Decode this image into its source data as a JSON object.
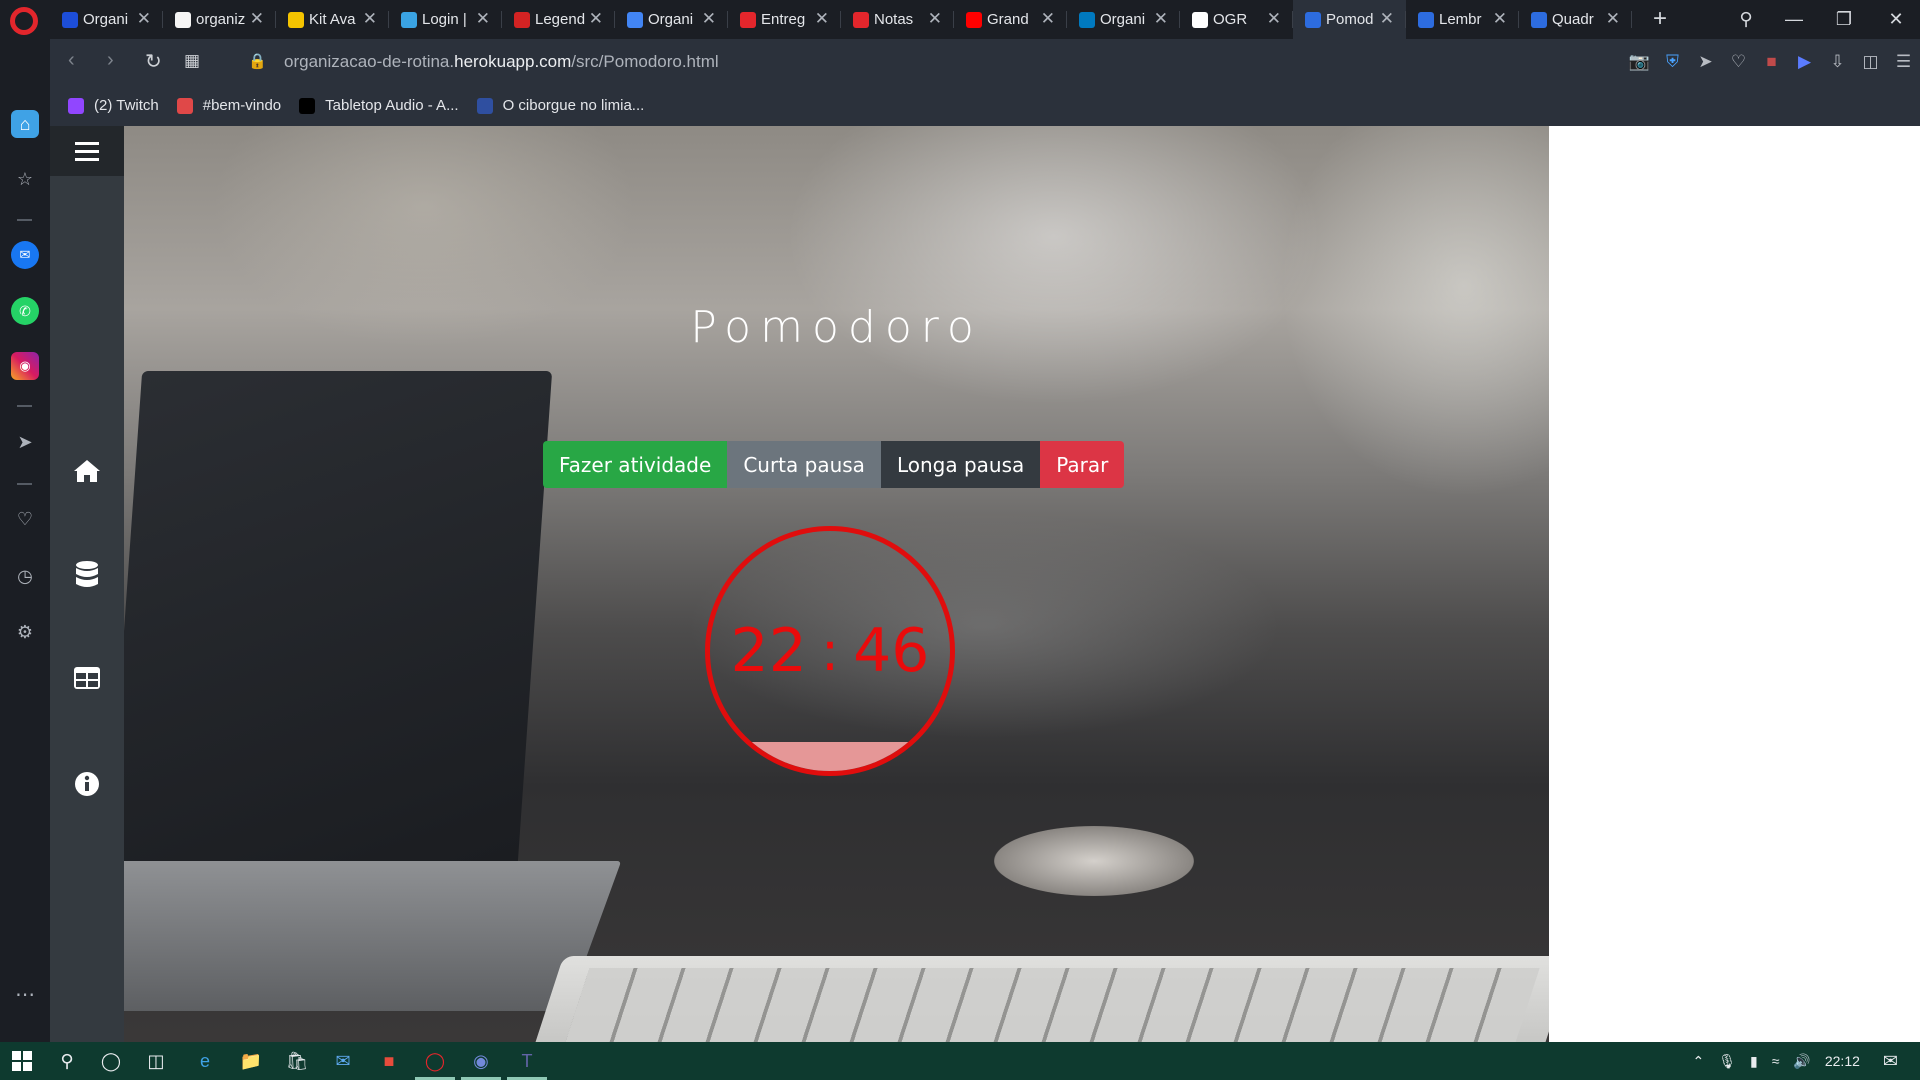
{
  "browser": {
    "tabs": [
      {
        "label": "Organi",
        "fav_color": "#1d4ed8"
      },
      {
        "label": "organiz",
        "fav_color": "#f5f5f5"
      },
      {
        "label": "Kit Ava",
        "fav_color": "#f5c400"
      },
      {
        "label": "Login |",
        "fav_color": "#3aa3e3"
      },
      {
        "label": "Legend",
        "fav_color": "#d32323"
      },
      {
        "label": "Organi",
        "fav_color": "#4285f4"
      },
      {
        "label": "Entreg",
        "fav_color": "#e3262c"
      },
      {
        "label": "Notas",
        "fav_color": "#e3262c"
      },
      {
        "label": "Grand",
        "fav_color": "#ff0000"
      },
      {
        "label": "Organi",
        "fav_color": "#0079bf"
      },
      {
        "label": "OGR",
        "fav_color": "#ffffff"
      },
      {
        "label": "Pomod",
        "fav_color": "#2d6cdf",
        "active": true
      },
      {
        "label": "Lembr",
        "fav_color": "#2d6cdf"
      },
      {
        "label": "Quadr",
        "fav_color": "#2d6cdf"
      }
    ],
    "url_prefix": "organizacao-de-rotina.",
    "url_domain": "herokuapp.com",
    "url_path": "/src/Pomodoro.html",
    "bookmarks": [
      {
        "label": "(2) Twitch",
        "fav_color": "#9146ff",
        "fav_text": "t"
      },
      {
        "label": "#bem-vindo",
        "fav_color": "#e04848",
        "fav_text": "55"
      },
      {
        "label": "Tabletop Audio - A...",
        "fav_color": "#000000",
        "fav_text": ""
      },
      {
        "label": "O ciborgue no limia...",
        "fav_color": "#2f4fa0",
        "fav_text": "E"
      }
    ]
  },
  "page": {
    "title": "Pomodoro",
    "buttons": {
      "activity": "Fazer atividade",
      "short_break": "Curta pausa",
      "long_break": "Longa pausa",
      "stop": "Parar"
    },
    "timer": {
      "minutes": "22",
      "separator": ":",
      "seconds": "46",
      "elapsed_fraction": 0.12,
      "color": "#e00d0d"
    }
  },
  "taskbar": {
    "time": "22:12"
  },
  "colors": {
    "success": "#28a745",
    "secondary": "#6c757d",
    "dark": "#343a40",
    "danger": "#dc3545"
  }
}
